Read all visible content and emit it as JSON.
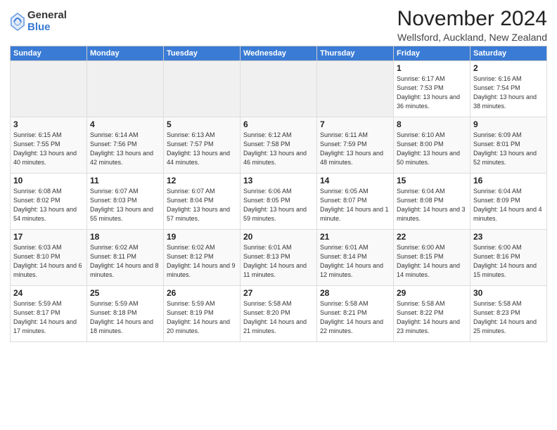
{
  "header": {
    "logo_general": "General",
    "logo_blue": "Blue",
    "title": "November 2024",
    "location": "Wellsford, Auckland, New Zealand"
  },
  "columns": [
    "Sunday",
    "Monday",
    "Tuesday",
    "Wednesday",
    "Thursday",
    "Friday",
    "Saturday"
  ],
  "weeks": [
    [
      {
        "day": "",
        "info": ""
      },
      {
        "day": "",
        "info": ""
      },
      {
        "day": "",
        "info": ""
      },
      {
        "day": "",
        "info": ""
      },
      {
        "day": "",
        "info": ""
      },
      {
        "day": "1",
        "info": "Sunrise: 6:17 AM\nSunset: 7:53 PM\nDaylight: 13 hours\nand 36 minutes."
      },
      {
        "day": "2",
        "info": "Sunrise: 6:16 AM\nSunset: 7:54 PM\nDaylight: 13 hours\nand 38 minutes."
      }
    ],
    [
      {
        "day": "3",
        "info": "Sunrise: 6:15 AM\nSunset: 7:55 PM\nDaylight: 13 hours\nand 40 minutes."
      },
      {
        "day": "4",
        "info": "Sunrise: 6:14 AM\nSunset: 7:56 PM\nDaylight: 13 hours\nand 42 minutes."
      },
      {
        "day": "5",
        "info": "Sunrise: 6:13 AM\nSunset: 7:57 PM\nDaylight: 13 hours\nand 44 minutes."
      },
      {
        "day": "6",
        "info": "Sunrise: 6:12 AM\nSunset: 7:58 PM\nDaylight: 13 hours\nand 46 minutes."
      },
      {
        "day": "7",
        "info": "Sunrise: 6:11 AM\nSunset: 7:59 PM\nDaylight: 13 hours\nand 48 minutes."
      },
      {
        "day": "8",
        "info": "Sunrise: 6:10 AM\nSunset: 8:00 PM\nDaylight: 13 hours\nand 50 minutes."
      },
      {
        "day": "9",
        "info": "Sunrise: 6:09 AM\nSunset: 8:01 PM\nDaylight: 13 hours\nand 52 minutes."
      }
    ],
    [
      {
        "day": "10",
        "info": "Sunrise: 6:08 AM\nSunset: 8:02 PM\nDaylight: 13 hours\nand 54 minutes."
      },
      {
        "day": "11",
        "info": "Sunrise: 6:07 AM\nSunset: 8:03 PM\nDaylight: 13 hours\nand 55 minutes."
      },
      {
        "day": "12",
        "info": "Sunrise: 6:07 AM\nSunset: 8:04 PM\nDaylight: 13 hours\nand 57 minutes."
      },
      {
        "day": "13",
        "info": "Sunrise: 6:06 AM\nSunset: 8:05 PM\nDaylight: 13 hours\nand 59 minutes."
      },
      {
        "day": "14",
        "info": "Sunrise: 6:05 AM\nSunset: 8:07 PM\nDaylight: 14 hours\nand 1 minute."
      },
      {
        "day": "15",
        "info": "Sunrise: 6:04 AM\nSunset: 8:08 PM\nDaylight: 14 hours\nand 3 minutes."
      },
      {
        "day": "16",
        "info": "Sunrise: 6:04 AM\nSunset: 8:09 PM\nDaylight: 14 hours\nand 4 minutes."
      }
    ],
    [
      {
        "day": "17",
        "info": "Sunrise: 6:03 AM\nSunset: 8:10 PM\nDaylight: 14 hours\nand 6 minutes."
      },
      {
        "day": "18",
        "info": "Sunrise: 6:02 AM\nSunset: 8:11 PM\nDaylight: 14 hours\nand 8 minutes."
      },
      {
        "day": "19",
        "info": "Sunrise: 6:02 AM\nSunset: 8:12 PM\nDaylight: 14 hours\nand 9 minutes."
      },
      {
        "day": "20",
        "info": "Sunrise: 6:01 AM\nSunset: 8:13 PM\nDaylight: 14 hours\nand 11 minutes."
      },
      {
        "day": "21",
        "info": "Sunrise: 6:01 AM\nSunset: 8:14 PM\nDaylight: 14 hours\nand 12 minutes."
      },
      {
        "day": "22",
        "info": "Sunrise: 6:00 AM\nSunset: 8:15 PM\nDaylight: 14 hours\nand 14 minutes."
      },
      {
        "day": "23",
        "info": "Sunrise: 6:00 AM\nSunset: 8:16 PM\nDaylight: 14 hours\nand 15 minutes."
      }
    ],
    [
      {
        "day": "24",
        "info": "Sunrise: 5:59 AM\nSunset: 8:17 PM\nDaylight: 14 hours\nand 17 minutes."
      },
      {
        "day": "25",
        "info": "Sunrise: 5:59 AM\nSunset: 8:18 PM\nDaylight: 14 hours\nand 18 minutes."
      },
      {
        "day": "26",
        "info": "Sunrise: 5:59 AM\nSunset: 8:19 PM\nDaylight: 14 hours\nand 20 minutes."
      },
      {
        "day": "27",
        "info": "Sunrise: 5:58 AM\nSunset: 8:20 PM\nDaylight: 14 hours\nand 21 minutes."
      },
      {
        "day": "28",
        "info": "Sunrise: 5:58 AM\nSunset: 8:21 PM\nDaylight: 14 hours\nand 22 minutes."
      },
      {
        "day": "29",
        "info": "Sunrise: 5:58 AM\nSunset: 8:22 PM\nDaylight: 14 hours\nand 23 minutes."
      },
      {
        "day": "30",
        "info": "Sunrise: 5:58 AM\nSunset: 8:23 PM\nDaylight: 14 hours\nand 25 minutes."
      }
    ]
  ]
}
